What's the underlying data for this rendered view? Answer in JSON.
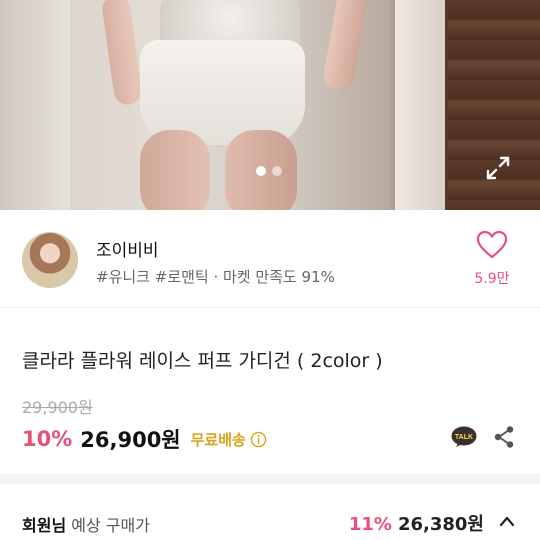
{
  "gallery": {
    "dot_count": 2,
    "active_index": 0
  },
  "seller": {
    "name": "조이비비",
    "tags": "#유니크 #로맨틱 · 마켓 만족도 91%",
    "like_count": "5.9만"
  },
  "product": {
    "title": "클라라 플라워 레이스 퍼프 가디건 ( 2color )",
    "original_price": "29,900원",
    "discount": "10%",
    "price": "26,900원",
    "shipping": "무료배송"
  },
  "member": {
    "label_bold": "회원님",
    "label_rest": " 예상 구매가",
    "discount": "11%",
    "price": "26,380원"
  },
  "colors": {
    "accent_pink": "#e8507a",
    "shipping_gold": "#d9a51a",
    "kakao_talk": "#3c2f2a"
  },
  "icons": [
    "expand-icon",
    "heart-icon",
    "info-icon",
    "kakao-talk-icon",
    "share-icon",
    "chevron-up-icon"
  ]
}
